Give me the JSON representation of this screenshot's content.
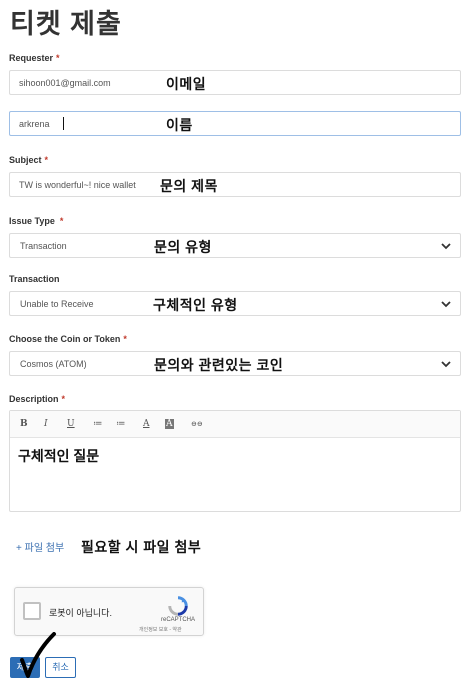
{
  "page": {
    "title": "티켓 제출"
  },
  "form": {
    "requester": {
      "label": "Requester",
      "required": "*",
      "value": "sihoon001@gmail.com",
      "annotation": "이메일"
    },
    "name": {
      "value": "arkrena",
      "annotation": "이름"
    },
    "subject": {
      "label": "Subject",
      "required": "*",
      "value": "TW is wonderful~! nice wallet",
      "annotation": "문의 제목"
    },
    "issue_type": {
      "label": "Issue Type",
      "required": "*",
      "value": "Transaction",
      "annotation": "문의 유형"
    },
    "transaction": {
      "label": "Transaction",
      "value": "Unable to Receive",
      "annotation": "구체적인 유형"
    },
    "coin": {
      "label": "Choose the Coin or Token",
      "required": "*",
      "value": "Cosmos (ATOM)",
      "annotation": "문의와 관련있는 코인"
    },
    "description": {
      "label": "Description",
      "required": "*",
      "value": "구체적인 질문"
    },
    "attach": {
      "label": "+ 파일 첨부",
      "annotation": "필요할 시 파일 첨부"
    }
  },
  "editor_toolbar": {
    "bold": "B",
    "italic": "I",
    "underline": "U",
    "bullet_list": "≔",
    "numbered_list": "≔",
    "text_color": "A",
    "text_bg": "A",
    "link": "⊖⊖"
  },
  "captcha": {
    "label": "로봇이 아닙니다.",
    "brand": "reCAPTCHA",
    "links": "개인정보 보호 - 약관"
  },
  "buttons": {
    "submit": "제출",
    "cancel": "취소"
  },
  "colors": {
    "accent": "#2c6db5",
    "required": "#c0392b",
    "recaptcha_blue": "#4a90e2"
  }
}
